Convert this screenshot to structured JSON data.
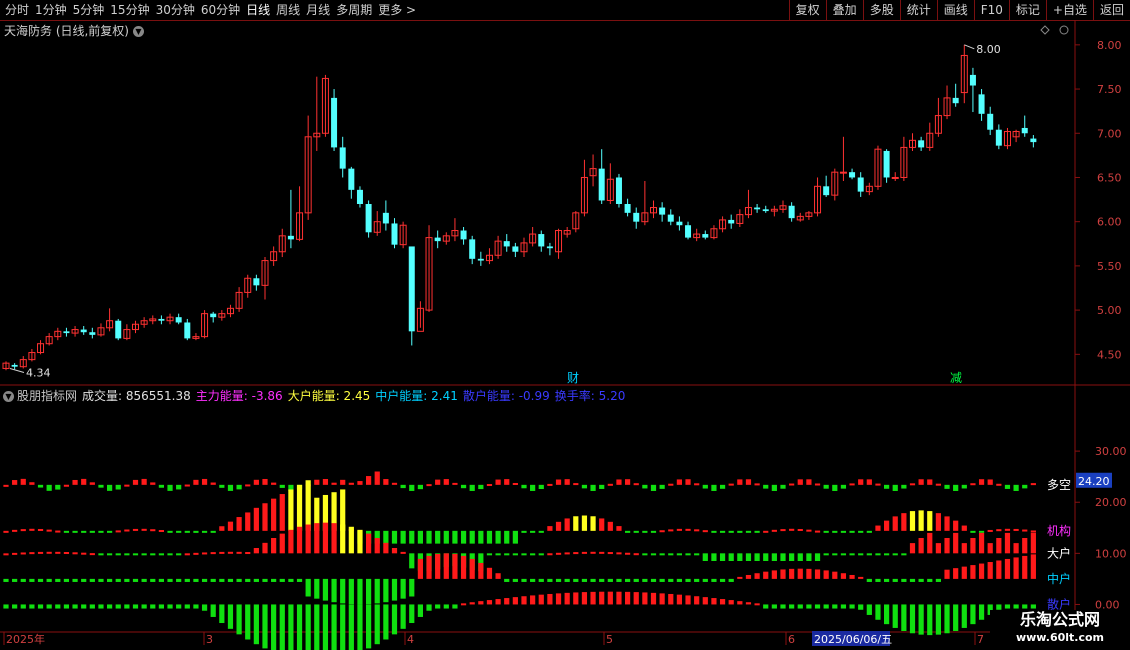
{
  "toolbar": {
    "left_items": [
      "分时",
      "1分钟",
      "5分钟",
      "15分钟",
      "30分钟",
      "60分钟",
      "日线",
      "周线",
      "月线",
      "多周期",
      "更多 >"
    ],
    "active_item": "日线",
    "right_items": [
      "复权",
      "叠加",
      "多股",
      "统计",
      "画线",
      "F10",
      "标记",
      "+自选",
      "返回"
    ]
  },
  "main_chart": {
    "title": "天海防务 (日线,前复权)",
    "price_ticks": [
      "8.00",
      "7.50",
      "7.00",
      "6.50",
      "6.00",
      "5.50",
      "5.00",
      "4.50"
    ],
    "high_label": "8.00",
    "low_label": "4.34",
    "event_markers": [
      {
        "label": "财",
        "color": "#00d0ff"
      },
      {
        "label": "减",
        "color": "#00ff44"
      }
    ]
  },
  "indicator": {
    "name": "股朋指标网",
    "items": [
      {
        "label": "成交量: 856551.38",
        "color": "#e0e0e0"
      },
      {
        "label": "主力能量: -3.86",
        "color": "#ff2fff"
      },
      {
        "label": "大户能量: 2.45",
        "color": "#ffff40"
      },
      {
        "label": "中户能量: 2.41",
        "color": "#00d0ff"
      },
      {
        "label": "散户能量: -0.99",
        "color": "#3a3aff"
      },
      {
        "label": "换手率: 5.20",
        "color": "#3a3aff"
      }
    ],
    "axis_ticks": [
      "30.00",
      "20.00",
      "10.00",
      "0.00"
    ],
    "current_value": "24.20",
    "row_labels": [
      {
        "label": "多空",
        "color": "#ffffff"
      },
      {
        "label": "机构",
        "color": "#ff2fff"
      },
      {
        "label": "大户",
        "color": "#ffffff"
      },
      {
        "label": "中户",
        "color": "#00d0ff"
      },
      {
        "label": "散户",
        "color": "#3a3aff"
      }
    ]
  },
  "date_axis": [
    "2025年",
    "3",
    "4",
    "5",
    "6",
    "7"
  ],
  "date_highlight": "2025/06/06/五",
  "watermark": {
    "title": "乐淘公式网",
    "url": "www.60lt.com"
  },
  "chart_data": {
    "type": "candlestick",
    "ylim": [
      4.3,
      8.1
    ],
    "candles": [
      [
        4.34,
        4.4,
        4.32,
        4.42
      ],
      [
        4.38,
        4.36,
        4.33,
        4.4
      ],
      [
        4.36,
        4.44,
        4.34,
        4.48
      ],
      [
        4.44,
        4.52,
        4.42,
        4.56
      ],
      [
        4.52,
        4.62,
        4.5,
        4.66
      ],
      [
        4.62,
        4.7,
        4.6,
        4.74
      ],
      [
        4.7,
        4.76,
        4.66,
        4.8
      ],
      [
        4.76,
        4.74,
        4.7,
        4.8
      ],
      [
        4.74,
        4.78,
        4.7,
        4.82
      ],
      [
        4.78,
        4.75,
        4.72,
        4.82
      ],
      [
        4.75,
        4.72,
        4.68,
        4.8
      ],
      [
        4.72,
        4.8,
        4.7,
        4.85
      ],
      [
        4.8,
        4.88,
        4.76,
        5.02
      ],
      [
        4.88,
        4.68,
        4.66,
        4.9
      ],
      [
        4.68,
        4.78,
        4.66,
        4.84
      ],
      [
        4.78,
        4.84,
        4.74,
        4.88
      ],
      [
        4.84,
        4.88,
        4.8,
        4.92
      ],
      [
        4.88,
        4.9,
        4.84,
        4.94
      ],
      [
        4.9,
        4.88,
        4.84,
        4.94
      ],
      [
        4.88,
        4.92,
        4.84,
        4.96
      ],
      [
        4.92,
        4.86,
        4.84,
        4.96
      ],
      [
        4.86,
        4.68,
        4.66,
        4.9
      ],
      [
        4.68,
        4.7,
        4.66,
        4.74
      ],
      [
        4.7,
        4.96,
        4.68,
        5.0
      ],
      [
        4.96,
        4.92,
        4.86,
        4.98
      ],
      [
        4.92,
        4.96,
        4.88,
        5.0
      ],
      [
        4.96,
        5.02,
        4.92,
        5.06
      ],
      [
        5.02,
        5.2,
        4.98,
        5.26
      ],
      [
        5.2,
        5.36,
        5.14,
        5.4
      ],
      [
        5.36,
        5.28,
        5.22,
        5.4
      ],
      [
        5.28,
        5.56,
        5.12,
        5.6
      ],
      [
        5.56,
        5.66,
        5.5,
        5.72
      ],
      [
        5.66,
        5.84,
        5.6,
        5.92
      ],
      [
        5.84,
        5.8,
        5.7,
        6.36
      ],
      [
        5.8,
        6.1,
        5.78,
        6.4
      ],
      [
        6.1,
        6.96,
        6.02,
        7.2
      ],
      [
        6.96,
        7.0,
        6.8,
        7.64
      ],
      [
        7.0,
        7.62,
        6.96,
        7.66
      ],
      [
        7.4,
        6.84,
        6.8,
        7.5
      ],
      [
        6.84,
        6.6,
        6.5,
        6.96
      ],
      [
        6.6,
        6.36,
        6.26,
        6.62
      ],
      [
        6.36,
        6.2,
        6.16,
        6.4
      ],
      [
        6.2,
        5.88,
        5.82,
        6.24
      ],
      [
        5.88,
        6.0,
        5.84,
        6.12
      ],
      [
        6.1,
        5.98,
        5.9,
        6.24
      ],
      [
        5.98,
        5.74,
        5.7,
        6.04
      ],
      [
        5.74,
        5.96,
        5.7,
        6.0
      ],
      [
        5.72,
        4.76,
        4.6,
        5.42
      ],
      [
        4.76,
        5.02,
        4.8,
        5.1
      ],
      [
        5.0,
        5.82,
        4.98,
        5.96
      ],
      [
        5.82,
        5.78,
        5.7,
        5.9
      ],
      [
        5.78,
        5.84,
        5.74,
        5.88
      ],
      [
        5.84,
        5.9,
        5.78,
        6.04
      ],
      [
        5.9,
        5.8,
        5.74,
        5.94
      ],
      [
        5.8,
        5.58,
        5.52,
        5.84
      ],
      [
        5.58,
        5.56,
        5.5,
        5.66
      ],
      [
        5.56,
        5.62,
        5.52,
        5.7
      ],
      [
        5.62,
        5.78,
        5.58,
        5.84
      ],
      [
        5.78,
        5.72,
        5.66,
        5.86
      ],
      [
        5.72,
        5.66,
        5.6,
        5.76
      ],
      [
        5.66,
        5.76,
        5.6,
        5.82
      ],
      [
        5.76,
        5.86,
        5.72,
        5.94
      ],
      [
        5.86,
        5.72,
        5.66,
        5.9
      ],
      [
        5.72,
        5.7,
        5.62,
        5.76
      ],
      [
        5.66,
        5.9,
        5.58,
        5.92
      ],
      [
        5.86,
        5.9,
        5.82,
        5.94
      ],
      [
        5.92,
        6.1,
        5.88,
        6.12
      ],
      [
        6.1,
        6.5,
        6.06,
        6.7
      ],
      [
        6.52,
        6.6,
        6.4,
        6.76
      ],
      [
        6.6,
        6.24,
        6.2,
        6.82
      ],
      [
        6.24,
        6.48,
        6.2,
        6.66
      ],
      [
        6.5,
        6.2,
        6.16,
        6.54
      ],
      [
        6.2,
        6.1,
        6.06,
        6.26
      ],
      [
        6.1,
        6.0,
        5.92,
        6.16
      ],
      [
        6.0,
        6.1,
        5.96,
        6.46
      ],
      [
        6.1,
        6.16,
        6.04,
        6.24
      ],
      [
        6.16,
        6.08,
        6.0,
        6.22
      ],
      [
        6.08,
        6.0,
        5.96,
        6.14
      ],
      [
        6.0,
        5.96,
        5.9,
        6.06
      ],
      [
        5.96,
        5.82,
        5.8,
        6.0
      ],
      [
        5.82,
        5.86,
        5.78,
        5.92
      ],
      [
        5.86,
        5.82,
        5.8,
        5.9
      ],
      [
        5.82,
        5.92,
        5.8,
        5.96
      ],
      [
        5.92,
        6.02,
        5.88,
        6.06
      ],
      [
        6.02,
        5.98,
        5.92,
        6.08
      ],
      [
        5.98,
        6.08,
        5.94,
        6.14
      ],
      [
        6.08,
        6.16,
        6.04,
        6.36
      ],
      [
        6.16,
        6.14,
        6.1,
        6.2
      ],
      [
        6.14,
        6.12,
        6.1,
        6.18
      ],
      [
        6.12,
        6.14,
        6.06,
        6.18
      ],
      [
        6.14,
        6.18,
        6.1,
        6.24
      ],
      [
        6.18,
        6.04,
        6.0,
        6.22
      ],
      [
        6.02,
        6.06,
        6.0,
        6.1
      ],
      [
        6.06,
        6.1,
        6.02,
        6.12
      ],
      [
        6.1,
        6.4,
        6.06,
        6.5
      ],
      [
        6.4,
        6.3,
        6.28,
        6.52
      ],
      [
        6.3,
        6.56,
        6.24,
        6.6
      ],
      [
        6.56,
        6.56,
        6.46,
        6.96
      ],
      [
        6.56,
        6.5,
        6.48,
        6.6
      ],
      [
        6.5,
        6.34,
        6.28,
        6.56
      ],
      [
        6.34,
        6.4,
        6.3,
        6.44
      ],
      [
        6.4,
        6.82,
        6.36,
        6.86
      ],
      [
        6.8,
        6.5,
        6.44,
        6.82
      ],
      [
        6.5,
        6.5,
        6.46,
        6.56
      ],
      [
        6.5,
        6.84,
        6.46,
        6.96
      ],
      [
        6.84,
        6.92,
        6.8,
        7.0
      ],
      [
        6.92,
        6.84,
        6.8,
        6.96
      ],
      [
        6.84,
        7.0,
        6.8,
        7.12
      ],
      [
        7.0,
        7.2,
        6.96,
        7.4
      ],
      [
        7.2,
        7.4,
        7.16,
        7.54
      ],
      [
        7.4,
        7.34,
        7.3,
        7.56
      ],
      [
        7.46,
        7.88,
        7.34,
        8.0
      ],
      [
        7.66,
        7.54,
        7.24,
        7.74
      ],
      [
        7.44,
        7.22,
        7.14,
        7.5
      ],
      [
        7.22,
        7.04,
        6.98,
        7.3
      ],
      [
        7.04,
        6.86,
        6.82,
        7.1
      ],
      [
        6.86,
        7.02,
        6.82,
        7.06
      ],
      [
        6.96,
        7.02,
        6.9,
        7.04
      ],
      [
        7.06,
        7.0,
        6.96,
        7.2
      ],
      [
        6.94,
        6.9,
        6.84,
        6.98
      ]
    ],
    "ind_axis_ylim": [
      -5,
      40
    ],
    "row_baselines": [
      23.4,
      14.4,
      10.0,
      5.0,
      0.0
    ]
  }
}
